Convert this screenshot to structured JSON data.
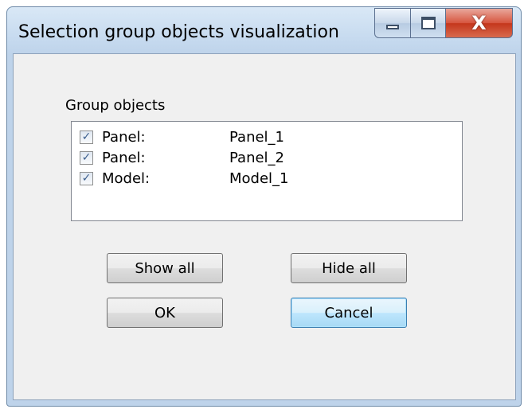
{
  "window": {
    "title": "Selection group objects visualization",
    "caption_icons": [
      "minimize-icon",
      "maximize-icon",
      "close-icon"
    ],
    "close_glyph": "X"
  },
  "group": {
    "label": "Group objects",
    "items": [
      {
        "type": "Panel:",
        "name": "Panel_1",
        "checked": true
      },
      {
        "type": "Panel:",
        "name": "Panel_2",
        "checked": true
      },
      {
        "type": "Model:",
        "name": "Model_1",
        "checked": true
      }
    ]
  },
  "buttons": {
    "show_all": "Show all",
    "hide_all": "Hide all",
    "ok": "OK",
    "cancel": "Cancel"
  },
  "colors": {
    "accent": "#3c7fb1",
    "close": "#c4361c",
    "check": "#3c5f8e"
  }
}
